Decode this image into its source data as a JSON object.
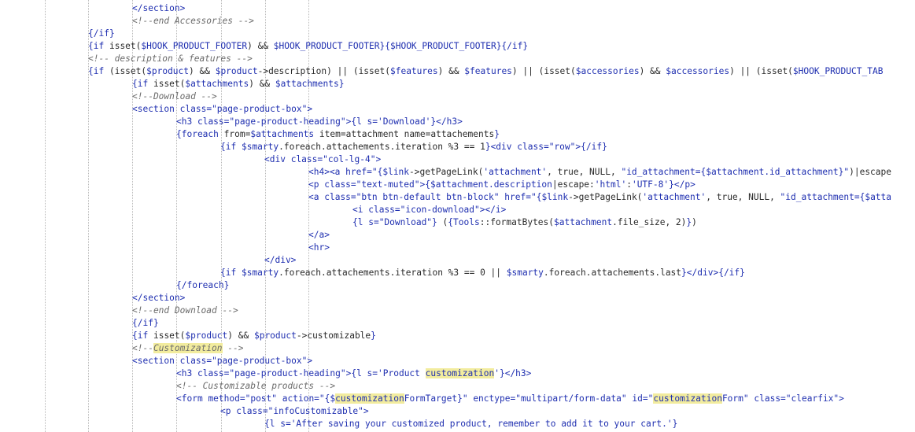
{
  "editor": {
    "highlight_term": "customization",
    "lines": [
      {
        "indent": 3,
        "html": "<span class=\"t\">&lt;/section&gt;</span>"
      },
      {
        "indent": 3,
        "html": "<span class=\"c\">&lt;!--end Accessories --&gt;</span>"
      },
      {
        "indent": 2,
        "html": "<span class=\"m\">{/if}</span>"
      },
      {
        "indent": 2,
        "html": "<span class=\"m\">{if</span> <span class=\"v\">isset(</span><span class=\"m\">$HOOK_PRODUCT_FOOTER</span><span class=\"v\">) &amp;&amp; </span><span class=\"m\">$HOOK_PRODUCT_FOOTER</span><span class=\"m\">}{$HOOK_PRODUCT_FOOTER}{/if}</span>"
      },
      {
        "indent": 2,
        "html": "<span class=\"c\">&lt;!-- description &amp; features --&gt;</span>"
      },
      {
        "indent": 2,
        "html": "<span class=\"m\">{if</span> <span class=\"v\">(isset(</span><span class=\"m\">$product</span><span class=\"v\">) &amp;&amp; </span><span class=\"m\">$product</span><span class=\"v\">-&gt;description) || (isset(</span><span class=\"m\">$features</span><span class=\"v\">) &amp;&amp; </span><span class=\"m\">$features</span><span class=\"v\">) || (isset(</span><span class=\"m\">$accessories</span><span class=\"v\">) &amp;&amp; </span><span class=\"m\">$accessories</span><span class=\"v\">) || (isset(</span><span class=\"m\">$HOOK_PRODUCT_TAB</span>"
      },
      {
        "indent": 3,
        "html": "<span class=\"m\">{if</span> <span class=\"v\">isset(</span><span class=\"m\">$attachments</span><span class=\"v\">) &amp;&amp; </span><span class=\"m\">$attachments</span><span class=\"m\">}</span>"
      },
      {
        "indent": 3,
        "html": "<span class=\"c\">&lt;!--Download --&gt;</span>"
      },
      {
        "indent": 3,
        "html": "<span class=\"t\">&lt;section</span> <span class=\"t\">class=</span><span class=\"s\">\"page-product-box\"</span><span class=\"t\">&gt;</span>"
      },
      {
        "indent": 4,
        "html": "<span class=\"t\">&lt;h3</span> <span class=\"t\">class=</span><span class=\"s\">\"page-product-heading\"</span><span class=\"t\">&gt;</span><span class=\"m\">{l s=</span><span class=\"s\">'Download'</span><span class=\"m\">}</span><span class=\"t\">&lt;/h3&gt;</span>"
      },
      {
        "indent": 4,
        "html": "<span class=\"m\">{foreach</span> <span class=\"v\">from=</span><span class=\"m\">$attachments</span> <span class=\"v\">item=attachment name=attachements</span><span class=\"m\">}</span>"
      },
      {
        "indent": 5,
        "html": "<span class=\"m\">{if</span> <span class=\"m\">$smarty</span><span class=\"v\">.foreach.attachements.iteration %3 == 1</span><span class=\"m\">}</span><span class=\"t\">&lt;div</span> <span class=\"t\">class=</span><span class=\"s\">\"row\"</span><span class=\"t\">&gt;</span><span class=\"m\">{/if}</span>"
      },
      {
        "indent": 6,
        "html": "<span class=\"t\">&lt;div</span> <span class=\"t\">class=</span><span class=\"s\">\"col-lg-4\"</span><span class=\"t\">&gt;</span>"
      },
      {
        "indent": 7,
        "html": "<span class=\"t\">&lt;h4&gt;&lt;a</span> <span class=\"t\">href=</span><span class=\"s\">\"</span><span class=\"m\">{$link</span><span class=\"v\">-&gt;getPageLink(</span><span class=\"s\">'attachment'</span><span class=\"v\">, true, NULL, </span><span class=\"s\">\"id_attachment=</span><span class=\"m\">{$attachment.id_attachment}</span><span class=\"s\">\"</span><span class=\"v\">)|escape</span>"
      },
      {
        "indent": 7,
        "html": "<span class=\"t\">&lt;p</span> <span class=\"t\">class=</span><span class=\"s\">\"text-muted\"</span><span class=\"t\">&gt;</span><span class=\"m\">{$attachment.description</span><span class=\"v\">|escape:</span><span class=\"s\">'html'</span><span class=\"v\">:</span><span class=\"s\">'UTF-8'</span><span class=\"m\">}</span><span class=\"t\">&lt;/p&gt;</span>"
      },
      {
        "indent": 7,
        "html": "<span class=\"t\">&lt;a</span> <span class=\"t\">class=</span><span class=\"s\">\"btn btn-default btn-block\"</span> <span class=\"t\">href=</span><span class=\"s\">\"</span><span class=\"m\">{$link</span><span class=\"v\">-&gt;getPageLink(</span><span class=\"s\">'attachment'</span><span class=\"v\">, true, NULL, </span><span class=\"s\">\"id_attachment=</span><span class=\"m\">{$atta</span>"
      },
      {
        "indent": 8,
        "html": "<span class=\"t\">&lt;i</span> <span class=\"t\">class=</span><span class=\"s\">\"icon-download\"</span><span class=\"t\">&gt;&lt;/i&gt;</span>"
      },
      {
        "indent": 8,
        "html": "<span class=\"m\">{l s=</span><span class=\"s\">\"Download\"</span><span class=\"m\">}</span> <span class=\"v\">(</span><span class=\"m\">{Tools</span><span class=\"v\">::formatBytes(</span><span class=\"m\">$attachment</span><span class=\"v\">.file_size, 2)</span><span class=\"m\">}</span><span class=\"v\">)</span>"
      },
      {
        "indent": 7,
        "html": "<span class=\"t\">&lt;/a&gt;</span>"
      },
      {
        "indent": 7,
        "html": "<span class=\"t\">&lt;hr&gt;</span>"
      },
      {
        "indent": 6,
        "html": "<span class=\"t\">&lt;/div&gt;</span>"
      },
      {
        "indent": 5,
        "html": "<span class=\"m\">{if</span> <span class=\"m\">$smarty</span><span class=\"v\">.foreach.attachements.iteration %3 == 0 || </span><span class=\"m\">$smarty</span><span class=\"v\">.foreach.attachements.last</span><span class=\"m\">}</span><span class=\"t\">&lt;/div&gt;</span><span class=\"m\">{/if}</span>"
      },
      {
        "indent": 4,
        "html": "<span class=\"m\">{/foreach}</span>"
      },
      {
        "indent": 3,
        "html": "<span class=\"t\">&lt;/section&gt;</span>"
      },
      {
        "indent": 3,
        "html": "<span class=\"c\">&lt;!--end Download --&gt;</span>"
      },
      {
        "indent": 3,
        "html": "<span class=\"m\">{/if}</span>"
      },
      {
        "indent": 3,
        "html": "<span class=\"m\">{if</span> <span class=\"v\">isset(</span><span class=\"m\">$product</span><span class=\"v\">) &amp;&amp; </span><span class=\"m\">$product</span><span class=\"v\">-&gt;customizable</span><span class=\"m\">}</span>"
      },
      {
        "indent": 3,
        "html": "<span class=\"c\">&lt;!--<span class=\"hl\">Customization</span> --&gt;</span>"
      },
      {
        "indent": 3,
        "html": "<span class=\"t\">&lt;section</span> <span class=\"t\">class=</span><span class=\"s\">\"page-product-box\"</span><span class=\"t\">&gt;</span>"
      },
      {
        "indent": 4,
        "html": "<span class=\"t\">&lt;h3</span> <span class=\"t\">class=</span><span class=\"s\">\"page-product-heading\"</span><span class=\"t\">&gt;</span><span class=\"m\">{l s=</span><span class=\"s\">'Product <span class=\"hl\">customization</span>'</span><span class=\"m\">}</span><span class=\"t\">&lt;/h3&gt;</span>"
      },
      {
        "indent": 4,
        "html": "<span class=\"c\">&lt;!-- Customizable products --&gt;</span>"
      },
      {
        "indent": 4,
        "html": "<span class=\"t\">&lt;form</span> <span class=\"t\">method=</span><span class=\"s\">\"post\"</span> <span class=\"t\">action=</span><span class=\"s\">\"</span><span class=\"m\">{$<span class=\"hl\">customization</span>FormTarget}</span><span class=\"s\">\"</span> <span class=\"t\">enctype=</span><span class=\"s\">\"multipart/form-data\"</span> <span class=\"t\">id=</span><span class=\"s\">\"<span class=\"hl\">customization</span>Form\"</span> <span class=\"t\">class=</span><span class=\"s\">\"clearfix\"</span><span class=\"t\">&gt;</span>"
      },
      {
        "indent": 5,
        "html": "<span class=\"t\">&lt;p</span> <span class=\"t\">class=</span><span class=\"s\">\"infoCustomizable\"</span><span class=\"t\">&gt;</span>"
      },
      {
        "indent": 6,
        "html": "<span class=\"m\">{l s=</span><span class=\"s\">'After saving your customized product, remember to add it to your cart.'</span><span class=\"m\">}</span>"
      }
    ]
  }
}
